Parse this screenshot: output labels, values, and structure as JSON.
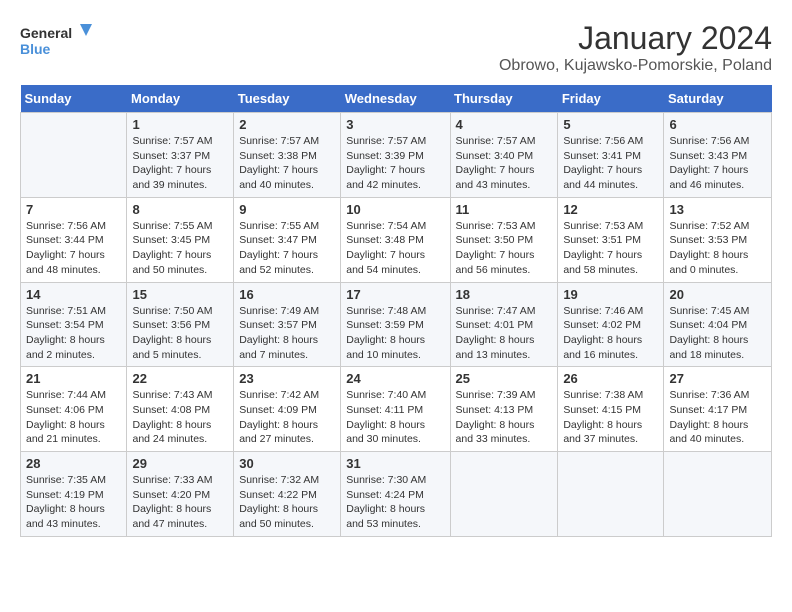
{
  "header": {
    "logo_line1": "General",
    "logo_line2": "Blue",
    "title": "January 2024",
    "subtitle": "Obrowo, Kujawsko-Pomorskie, Poland"
  },
  "days_of_week": [
    "Sunday",
    "Monday",
    "Tuesday",
    "Wednesday",
    "Thursday",
    "Friday",
    "Saturday"
  ],
  "weeks": [
    [
      {
        "day": "",
        "info": ""
      },
      {
        "day": "1",
        "info": "Sunrise: 7:57 AM\nSunset: 3:37 PM\nDaylight: 7 hours\nand 39 minutes."
      },
      {
        "day": "2",
        "info": "Sunrise: 7:57 AM\nSunset: 3:38 PM\nDaylight: 7 hours\nand 40 minutes."
      },
      {
        "day": "3",
        "info": "Sunrise: 7:57 AM\nSunset: 3:39 PM\nDaylight: 7 hours\nand 42 minutes."
      },
      {
        "day": "4",
        "info": "Sunrise: 7:57 AM\nSunset: 3:40 PM\nDaylight: 7 hours\nand 43 minutes."
      },
      {
        "day": "5",
        "info": "Sunrise: 7:56 AM\nSunset: 3:41 PM\nDaylight: 7 hours\nand 44 minutes."
      },
      {
        "day": "6",
        "info": "Sunrise: 7:56 AM\nSunset: 3:43 PM\nDaylight: 7 hours\nand 46 minutes."
      }
    ],
    [
      {
        "day": "7",
        "info": "Sunrise: 7:56 AM\nSunset: 3:44 PM\nDaylight: 7 hours\nand 48 minutes."
      },
      {
        "day": "8",
        "info": "Sunrise: 7:55 AM\nSunset: 3:45 PM\nDaylight: 7 hours\nand 50 minutes."
      },
      {
        "day": "9",
        "info": "Sunrise: 7:55 AM\nSunset: 3:47 PM\nDaylight: 7 hours\nand 52 minutes."
      },
      {
        "day": "10",
        "info": "Sunrise: 7:54 AM\nSunset: 3:48 PM\nDaylight: 7 hours\nand 54 minutes."
      },
      {
        "day": "11",
        "info": "Sunrise: 7:53 AM\nSunset: 3:50 PM\nDaylight: 7 hours\nand 56 minutes."
      },
      {
        "day": "12",
        "info": "Sunrise: 7:53 AM\nSunset: 3:51 PM\nDaylight: 7 hours\nand 58 minutes."
      },
      {
        "day": "13",
        "info": "Sunrise: 7:52 AM\nSunset: 3:53 PM\nDaylight: 8 hours\nand 0 minutes."
      }
    ],
    [
      {
        "day": "14",
        "info": "Sunrise: 7:51 AM\nSunset: 3:54 PM\nDaylight: 8 hours\nand 2 minutes."
      },
      {
        "day": "15",
        "info": "Sunrise: 7:50 AM\nSunset: 3:56 PM\nDaylight: 8 hours\nand 5 minutes."
      },
      {
        "day": "16",
        "info": "Sunrise: 7:49 AM\nSunset: 3:57 PM\nDaylight: 8 hours\nand 7 minutes."
      },
      {
        "day": "17",
        "info": "Sunrise: 7:48 AM\nSunset: 3:59 PM\nDaylight: 8 hours\nand 10 minutes."
      },
      {
        "day": "18",
        "info": "Sunrise: 7:47 AM\nSunset: 4:01 PM\nDaylight: 8 hours\nand 13 minutes."
      },
      {
        "day": "19",
        "info": "Sunrise: 7:46 AM\nSunset: 4:02 PM\nDaylight: 8 hours\nand 16 minutes."
      },
      {
        "day": "20",
        "info": "Sunrise: 7:45 AM\nSunset: 4:04 PM\nDaylight: 8 hours\nand 18 minutes."
      }
    ],
    [
      {
        "day": "21",
        "info": "Sunrise: 7:44 AM\nSunset: 4:06 PM\nDaylight: 8 hours\nand 21 minutes."
      },
      {
        "day": "22",
        "info": "Sunrise: 7:43 AM\nSunset: 4:08 PM\nDaylight: 8 hours\nand 24 minutes."
      },
      {
        "day": "23",
        "info": "Sunrise: 7:42 AM\nSunset: 4:09 PM\nDaylight: 8 hours\nand 27 minutes."
      },
      {
        "day": "24",
        "info": "Sunrise: 7:40 AM\nSunset: 4:11 PM\nDaylight: 8 hours\nand 30 minutes."
      },
      {
        "day": "25",
        "info": "Sunrise: 7:39 AM\nSunset: 4:13 PM\nDaylight: 8 hours\nand 33 minutes."
      },
      {
        "day": "26",
        "info": "Sunrise: 7:38 AM\nSunset: 4:15 PM\nDaylight: 8 hours\nand 37 minutes."
      },
      {
        "day": "27",
        "info": "Sunrise: 7:36 AM\nSunset: 4:17 PM\nDaylight: 8 hours\nand 40 minutes."
      }
    ],
    [
      {
        "day": "28",
        "info": "Sunrise: 7:35 AM\nSunset: 4:19 PM\nDaylight: 8 hours\nand 43 minutes."
      },
      {
        "day": "29",
        "info": "Sunrise: 7:33 AM\nSunset: 4:20 PM\nDaylight: 8 hours\nand 47 minutes."
      },
      {
        "day": "30",
        "info": "Sunrise: 7:32 AM\nSunset: 4:22 PM\nDaylight: 8 hours\nand 50 minutes."
      },
      {
        "day": "31",
        "info": "Sunrise: 7:30 AM\nSunset: 4:24 PM\nDaylight: 8 hours\nand 53 minutes."
      },
      {
        "day": "",
        "info": ""
      },
      {
        "day": "",
        "info": ""
      },
      {
        "day": "",
        "info": ""
      }
    ]
  ]
}
